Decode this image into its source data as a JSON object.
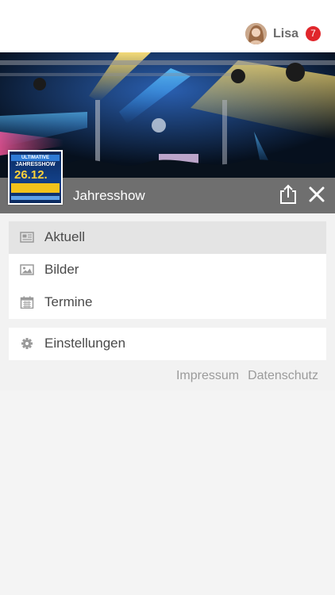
{
  "header": {
    "user_name": "Lisa",
    "notification_count": "7",
    "badge_color": "#e0262b"
  },
  "event": {
    "title": "Jahresshow",
    "poster": {
      "line1": "ULTIMATIVE",
      "line2": "JAHRESSHOW",
      "date": "26.12."
    },
    "icons": [
      "share-icon",
      "close-icon"
    ]
  },
  "menu": {
    "items": [
      {
        "label": "Aktuell",
        "icon": "newspaper-icon",
        "active": true
      },
      {
        "label": "Bilder",
        "icon": "image-icon",
        "active": false
      },
      {
        "label": "Termine",
        "icon": "calendar-icon",
        "active": false
      }
    ],
    "settings_label": "Einstellungen"
  },
  "footer_links": {
    "impressum": "Impressum",
    "datenschutz": "Datenschutz"
  },
  "colors": {
    "titlebar": "#6f6f6f",
    "active_item": "#e4e4e4",
    "background": "#f2f2f2"
  }
}
